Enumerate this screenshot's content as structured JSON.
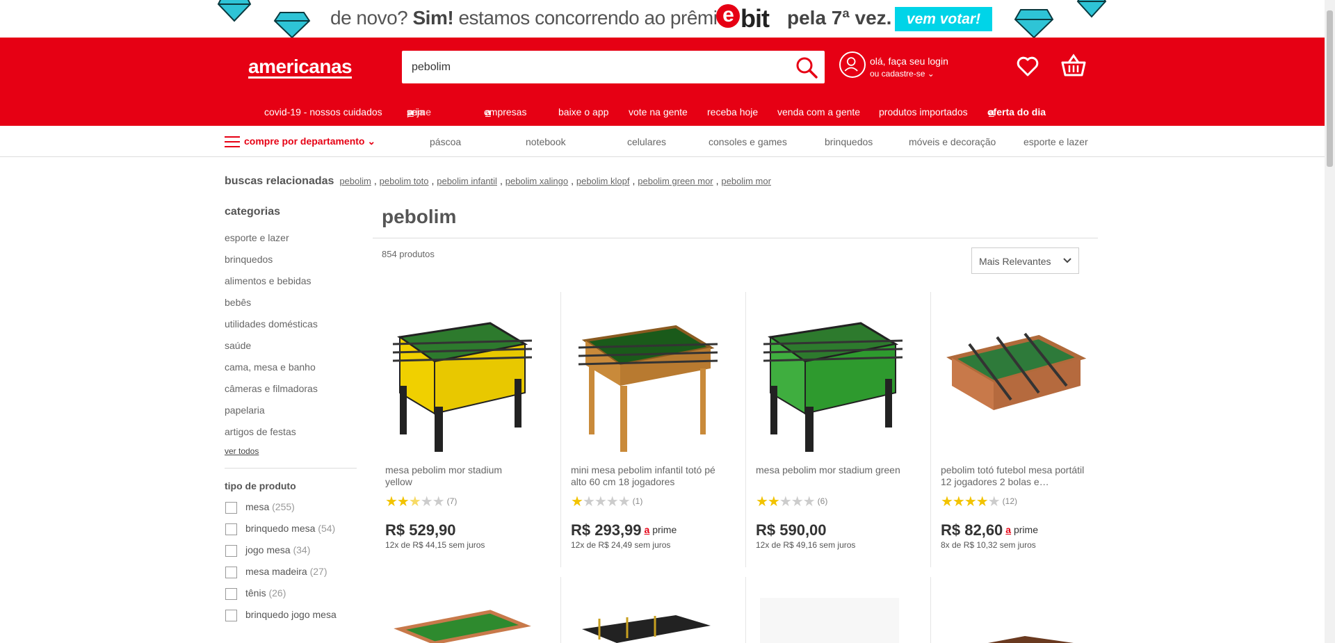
{
  "promo": {
    "text_a": "de novo? ",
    "text_b": "Sim!",
    "text_c": " estamos concorrendo ao prêmio",
    "ebit_e": "e",
    "ebit_rest": "bit",
    "text_d": "pela 7ª vez.",
    "vote_label": "vem votar!"
  },
  "header": {
    "logo": "americanas",
    "search_value": "pebolim",
    "login_line1": "olá, faça seu login",
    "login_line2": "ou cadastre-se"
  },
  "topnav": {
    "items": [
      "covid-19 - nossos cuidados",
      "seja",
      "prime",
      "empresas",
      "baixe o app",
      "vote na gente",
      "receba hoje",
      "venda com a gente",
      "produtos importados",
      "oferta do dia"
    ],
    "a_glyph": "a"
  },
  "depts": {
    "menu_label": "compre por departamento",
    "items": [
      "páscoa",
      "notebook",
      "celulares",
      "consoles e games",
      "brinquedos",
      "móveis e decoração",
      "esporte e lazer"
    ]
  },
  "related": {
    "label": "buscas relacionadas",
    "items": [
      "pebolim",
      "pebolim toto",
      "pebolim infantil",
      "pebolim xalingo",
      "pebolim klopf",
      "pebolim green mor",
      "pebolim mor"
    ]
  },
  "sidebar": {
    "categories_title": "categorias",
    "categories": [
      "esporte e lazer",
      "brinquedos",
      "alimentos e bebidas",
      "bebês",
      "utilidades domésticas",
      "saúde",
      "cama, mesa e banho",
      "câmeras e filmadoras",
      "papelaria",
      "artigos de festas"
    ],
    "see_all": "ver todos",
    "filter_title": "tipo de produto",
    "filters": [
      {
        "label": "mesa",
        "count": "(255)"
      },
      {
        "label": "brinquedo mesa",
        "count": "(54)"
      },
      {
        "label": "jogo mesa",
        "count": "(34)"
      },
      {
        "label": "mesa madeira",
        "count": "(27)"
      },
      {
        "label": "tênis",
        "count": "(26)"
      },
      {
        "label": "brinquedo jogo mesa",
        "count": ""
      }
    ]
  },
  "results": {
    "title": "pebolim",
    "count": "854 produtos",
    "sort_value": "Mais Relevantes"
  },
  "products": [
    {
      "name": "mesa pebolim mor stadium yellow",
      "rating": 2.5,
      "reviews": "(7)",
      "price": "R$ 529,90",
      "prime": false,
      "installments": "12x de R$ 44,15 sem juros",
      "color": "yellow"
    },
    {
      "name": "mini mesa pebolim infantil totó pé alto 60 cm 18 jogadores",
      "rating": 1,
      "reviews": "(1)",
      "price": "R$ 293,99",
      "prime": true,
      "installments": "12x de R$ 24,49 sem juros",
      "color": "wood"
    },
    {
      "name": "mesa pebolim mor stadium green",
      "rating": 2,
      "reviews": "(6)",
      "price": "R$ 590,00",
      "prime": false,
      "installments": "12x de R$ 49,16 sem juros",
      "color": "green"
    },
    {
      "name": "pebolim totó futebol mesa portátil 12 jogadores 2 bolas e…",
      "rating": 4,
      "reviews": "(12)",
      "price": "R$ 82,60",
      "prime": true,
      "installments": "8x de R$ 10,32 sem juros",
      "color": "mini"
    }
  ],
  "prime_label": "prime",
  "colors": {
    "brand_red": "#e60014",
    "promo_cyan": "#00d4e8",
    "star": "#f2c300"
  }
}
